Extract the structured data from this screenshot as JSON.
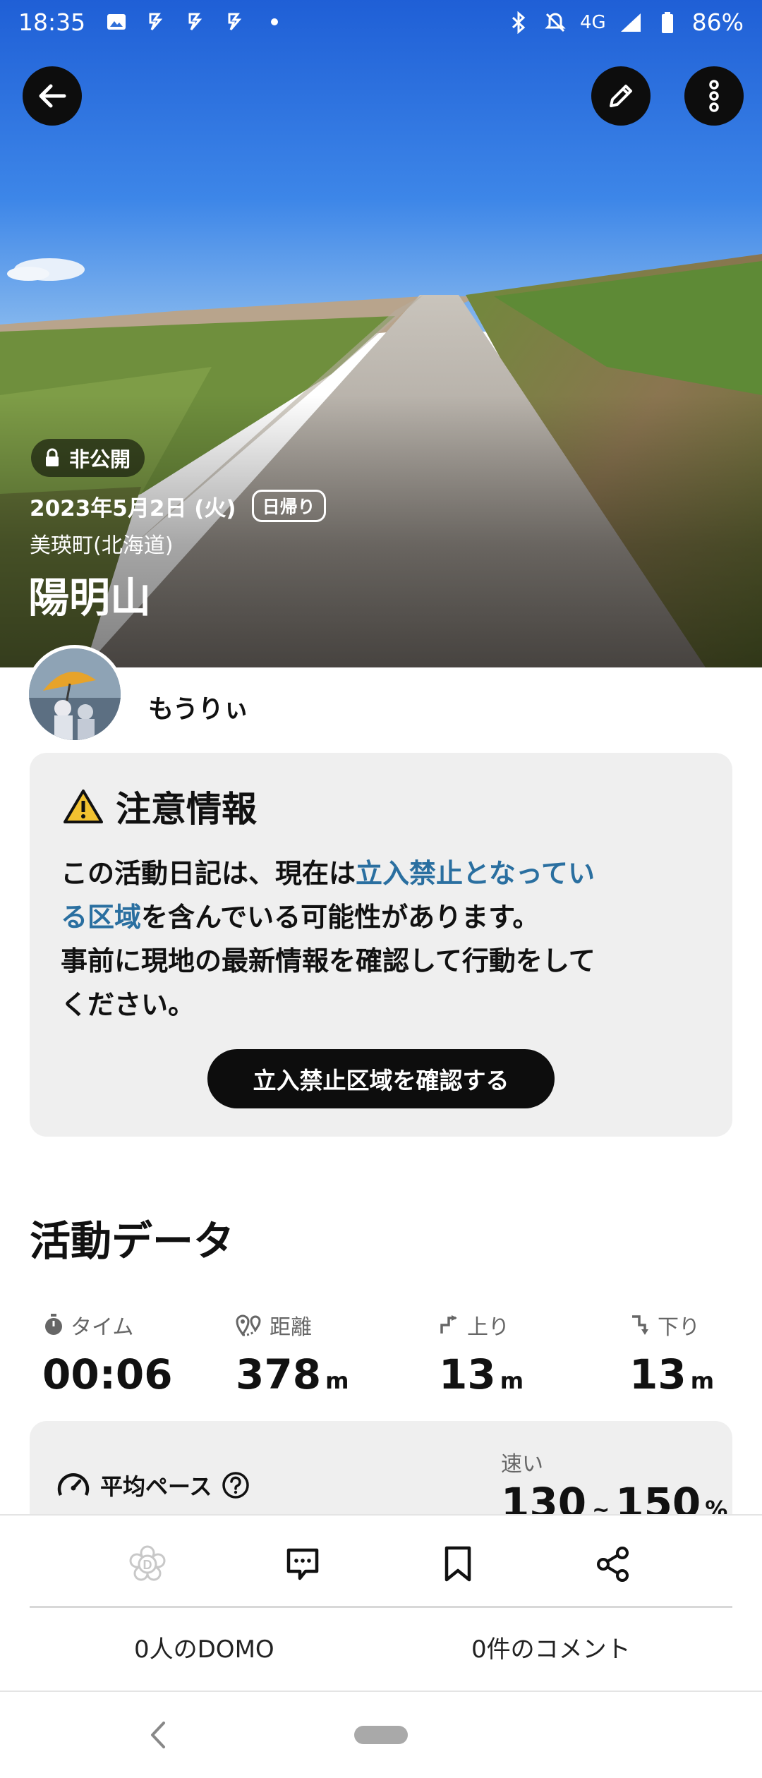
{
  "status_bar": {
    "time": "18:35",
    "network": "4G",
    "battery": "86%"
  },
  "header": {
    "back_icon": "arrow-left-icon",
    "edit_icon": "pencil-icon",
    "more_icon": "more-vertical-icon"
  },
  "activity": {
    "visibility": "非公開",
    "date": "2023年5月2日 (火)",
    "trip_type": "日帰り",
    "area": "美瑛町(北海道)",
    "mountain": "陽明山"
  },
  "author": {
    "name": "もうりぃ"
  },
  "caution": {
    "title": "注意情報",
    "line1_pre": "この活動日記は、現在は",
    "line1_link": "立入禁止となってい",
    "line2_link": "る区域",
    "line2_post": "を含んでいる可能性があります。",
    "line3": "事前に現地の最新情報を確認して行動をして",
    "line4": "ください。",
    "button": "立入禁止区域を確認する"
  },
  "activity_data": {
    "title": "活動データ",
    "stats": [
      {
        "label": "タイム",
        "value": "00:06",
        "unit": ""
      },
      {
        "label": "距離",
        "value": "378",
        "unit": "m"
      },
      {
        "label": "上り",
        "value": "13",
        "unit": "m"
      },
      {
        "label": "下り",
        "value": "13",
        "unit": "m"
      }
    ],
    "pace": {
      "label": "平均ペース",
      "speed_label": "速い",
      "range_low": "130",
      "range_sep": "~",
      "range_high": "150",
      "unit": "%"
    }
  },
  "actions": {
    "domo_count": "0人のDOMO",
    "comment_count": "0件のコメント"
  },
  "colors": {
    "link": "#2a6fa0",
    "card_bg": "#efefef",
    "button_bg": "#0d0d0d",
    "caution_yellow": "#f2c230"
  }
}
